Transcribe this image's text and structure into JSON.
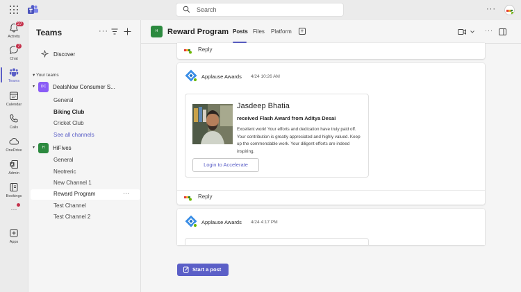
{
  "topbar": {
    "search_placeholder": "Search",
    "more_label": "···",
    "colors": {
      "accent": "#5b5fc7",
      "badge": "#c4314b"
    }
  },
  "rail": {
    "items": [
      {
        "label": "Activity",
        "icon": "bell-icon",
        "badge": "27"
      },
      {
        "label": "Chat",
        "icon": "chat-icon",
        "badge": "7"
      },
      {
        "label": "Teams",
        "icon": "teams-icon",
        "active": true
      },
      {
        "label": "Calendar",
        "icon": "calendar-icon"
      },
      {
        "label": "Calls",
        "icon": "phone-icon"
      },
      {
        "label": "OneDrive",
        "icon": "cloud-icon"
      },
      {
        "label": "Admin",
        "icon": "admin-icon"
      },
      {
        "label": "Bookings",
        "icon": "bookings-icon"
      },
      {
        "label": "···",
        "icon": "more-apps-icon"
      },
      {
        "label": "Apps",
        "icon": "apps-icon"
      }
    ]
  },
  "panel": {
    "title": "Teams",
    "more": "···",
    "discover": "Discover",
    "your_teams": "Your teams",
    "teams": [
      {
        "name": "DealsNow Consumer S...",
        "avatar_text": "DC",
        "avatar_color": "#8a5cf6",
        "channels": [
          "General",
          "Biking Club",
          "Cricket Club",
          "See all channels"
        ]
      },
      {
        "name": "HiFives",
        "avatar_text": "H",
        "avatar_color": "#2c8a3f",
        "channels": [
          "General",
          "Neotreric",
          "New Channel 1",
          "Reward Program",
          "Test Channel",
          "Test Channel 2"
        ]
      }
    ],
    "channel_more": "···"
  },
  "main": {
    "avatar_text": "H",
    "channel_title": "Reward Program",
    "tabs": [
      "Posts",
      "Files",
      "Platform"
    ],
    "more": "···",
    "reply_label": "Reply",
    "posts": [
      {
        "author": "Applause Awards",
        "time": "4/24 10:26 AM",
        "card": {
          "recipient": "Jasdeep Bhatia",
          "award_line": "received Flash Award from Aditya Desai",
          "message": "Excellent work! Your efforts and dedication have truly paid off. Your contribution is greatly appreciated and highly valued. Keep up the commendable work. Your diligent efforts are indeed inspiring.",
          "button": "Login to Accelerate"
        }
      },
      {
        "author": "Applause Awards",
        "time": "4/24 4:17 PM"
      }
    ],
    "start_post": "Start a post"
  }
}
